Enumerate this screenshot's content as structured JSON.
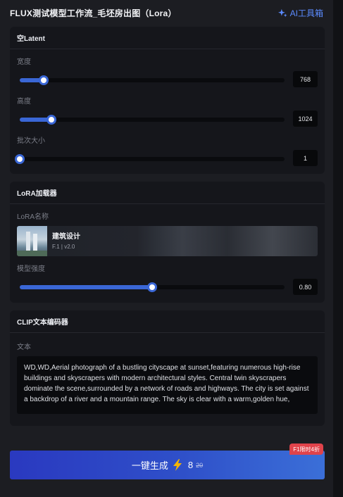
{
  "header": {
    "title": "FLUX测试模型工作流_毛坯房出图（Lora）",
    "ai_tools_label": "AI工具箱"
  },
  "latent": {
    "title": "空Latent",
    "width_label": "宽度",
    "width_value": "768",
    "width_fraction": 0.09,
    "height_label": "高度",
    "height_value": "1024",
    "height_fraction": 0.12,
    "batch_label": "批次大小",
    "batch_value": "1",
    "batch_fraction": 0.0
  },
  "lora": {
    "title": "LoRA加载器",
    "name_label": "LoRA名称",
    "model_name": "建筑设计",
    "model_meta": "F.1 | v2.0",
    "strength_label": "模型强度",
    "strength_value": "0.80",
    "strength_fraction": 0.5
  },
  "clip": {
    "title": "CLIP文本编码器",
    "text_label": "文本",
    "text_value": "WD,WD,Aerial photograph of a bustling cityscape at sunset,featuring numerous high-rise buildings and skyscrapers with modern architectural styles. Central twin skyscrapers dominate the scene,surrounded by a network of roads and highways. The city is set against a backdrop of a river and a mountain range. The sky is clear with a warm,golden hue,"
  },
  "generate": {
    "label": "一键生成",
    "cost": "8",
    "original_cost": "20",
    "badge": "F1限时4折",
    "icon": "lightning-icon"
  },
  "colors": {
    "accent": "#3a67d6",
    "link": "#5b8bff",
    "badge": "#e0434b",
    "lightning": "#f5b400"
  }
}
